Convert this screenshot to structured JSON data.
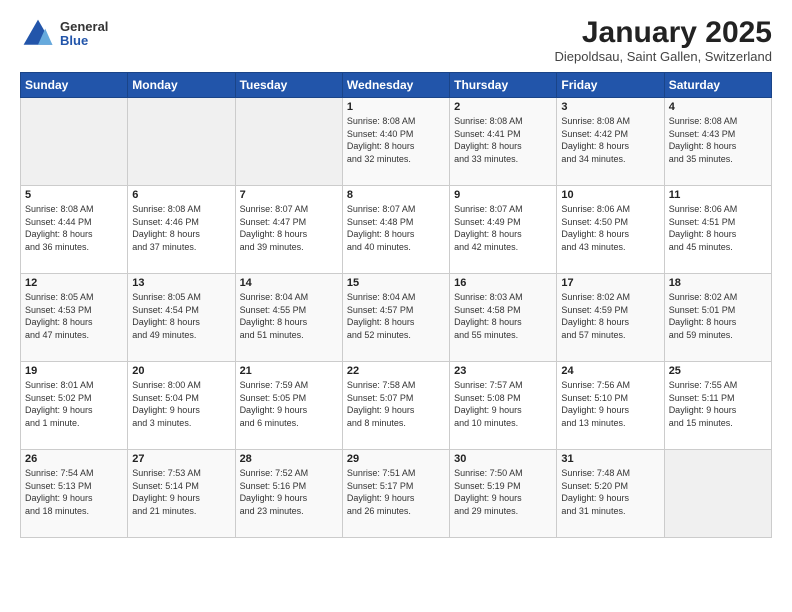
{
  "logo": {
    "general": "General",
    "blue": "Blue"
  },
  "header": {
    "title": "January 2025",
    "subtitle": "Diepoldsau, Saint Gallen, Switzerland"
  },
  "days_of_week": [
    "Sunday",
    "Monday",
    "Tuesday",
    "Wednesday",
    "Thursday",
    "Friday",
    "Saturday"
  ],
  "weeks": [
    [
      {
        "day": "",
        "info": ""
      },
      {
        "day": "",
        "info": ""
      },
      {
        "day": "",
        "info": ""
      },
      {
        "day": "1",
        "info": "Sunrise: 8:08 AM\nSunset: 4:40 PM\nDaylight: 8 hours\nand 32 minutes."
      },
      {
        "day": "2",
        "info": "Sunrise: 8:08 AM\nSunset: 4:41 PM\nDaylight: 8 hours\nand 33 minutes."
      },
      {
        "day": "3",
        "info": "Sunrise: 8:08 AM\nSunset: 4:42 PM\nDaylight: 8 hours\nand 34 minutes."
      },
      {
        "day": "4",
        "info": "Sunrise: 8:08 AM\nSunset: 4:43 PM\nDaylight: 8 hours\nand 35 minutes."
      }
    ],
    [
      {
        "day": "5",
        "info": "Sunrise: 8:08 AM\nSunset: 4:44 PM\nDaylight: 8 hours\nand 36 minutes."
      },
      {
        "day": "6",
        "info": "Sunrise: 8:08 AM\nSunset: 4:46 PM\nDaylight: 8 hours\nand 37 minutes."
      },
      {
        "day": "7",
        "info": "Sunrise: 8:07 AM\nSunset: 4:47 PM\nDaylight: 8 hours\nand 39 minutes."
      },
      {
        "day": "8",
        "info": "Sunrise: 8:07 AM\nSunset: 4:48 PM\nDaylight: 8 hours\nand 40 minutes."
      },
      {
        "day": "9",
        "info": "Sunrise: 8:07 AM\nSunset: 4:49 PM\nDaylight: 8 hours\nand 42 minutes."
      },
      {
        "day": "10",
        "info": "Sunrise: 8:06 AM\nSunset: 4:50 PM\nDaylight: 8 hours\nand 43 minutes."
      },
      {
        "day": "11",
        "info": "Sunrise: 8:06 AM\nSunset: 4:51 PM\nDaylight: 8 hours\nand 45 minutes."
      }
    ],
    [
      {
        "day": "12",
        "info": "Sunrise: 8:05 AM\nSunset: 4:53 PM\nDaylight: 8 hours\nand 47 minutes."
      },
      {
        "day": "13",
        "info": "Sunrise: 8:05 AM\nSunset: 4:54 PM\nDaylight: 8 hours\nand 49 minutes."
      },
      {
        "day": "14",
        "info": "Sunrise: 8:04 AM\nSunset: 4:55 PM\nDaylight: 8 hours\nand 51 minutes."
      },
      {
        "day": "15",
        "info": "Sunrise: 8:04 AM\nSunset: 4:57 PM\nDaylight: 8 hours\nand 52 minutes."
      },
      {
        "day": "16",
        "info": "Sunrise: 8:03 AM\nSunset: 4:58 PM\nDaylight: 8 hours\nand 55 minutes."
      },
      {
        "day": "17",
        "info": "Sunrise: 8:02 AM\nSunset: 4:59 PM\nDaylight: 8 hours\nand 57 minutes."
      },
      {
        "day": "18",
        "info": "Sunrise: 8:02 AM\nSunset: 5:01 PM\nDaylight: 8 hours\nand 59 minutes."
      }
    ],
    [
      {
        "day": "19",
        "info": "Sunrise: 8:01 AM\nSunset: 5:02 PM\nDaylight: 9 hours\nand 1 minute."
      },
      {
        "day": "20",
        "info": "Sunrise: 8:00 AM\nSunset: 5:04 PM\nDaylight: 9 hours\nand 3 minutes."
      },
      {
        "day": "21",
        "info": "Sunrise: 7:59 AM\nSunset: 5:05 PM\nDaylight: 9 hours\nand 6 minutes."
      },
      {
        "day": "22",
        "info": "Sunrise: 7:58 AM\nSunset: 5:07 PM\nDaylight: 9 hours\nand 8 minutes."
      },
      {
        "day": "23",
        "info": "Sunrise: 7:57 AM\nSunset: 5:08 PM\nDaylight: 9 hours\nand 10 minutes."
      },
      {
        "day": "24",
        "info": "Sunrise: 7:56 AM\nSunset: 5:10 PM\nDaylight: 9 hours\nand 13 minutes."
      },
      {
        "day": "25",
        "info": "Sunrise: 7:55 AM\nSunset: 5:11 PM\nDaylight: 9 hours\nand 15 minutes."
      }
    ],
    [
      {
        "day": "26",
        "info": "Sunrise: 7:54 AM\nSunset: 5:13 PM\nDaylight: 9 hours\nand 18 minutes."
      },
      {
        "day": "27",
        "info": "Sunrise: 7:53 AM\nSunset: 5:14 PM\nDaylight: 9 hours\nand 21 minutes."
      },
      {
        "day": "28",
        "info": "Sunrise: 7:52 AM\nSunset: 5:16 PM\nDaylight: 9 hours\nand 23 minutes."
      },
      {
        "day": "29",
        "info": "Sunrise: 7:51 AM\nSunset: 5:17 PM\nDaylight: 9 hours\nand 26 minutes."
      },
      {
        "day": "30",
        "info": "Sunrise: 7:50 AM\nSunset: 5:19 PM\nDaylight: 9 hours\nand 29 minutes."
      },
      {
        "day": "31",
        "info": "Sunrise: 7:48 AM\nSunset: 5:20 PM\nDaylight: 9 hours\nand 31 minutes."
      },
      {
        "day": "",
        "info": ""
      }
    ]
  ]
}
